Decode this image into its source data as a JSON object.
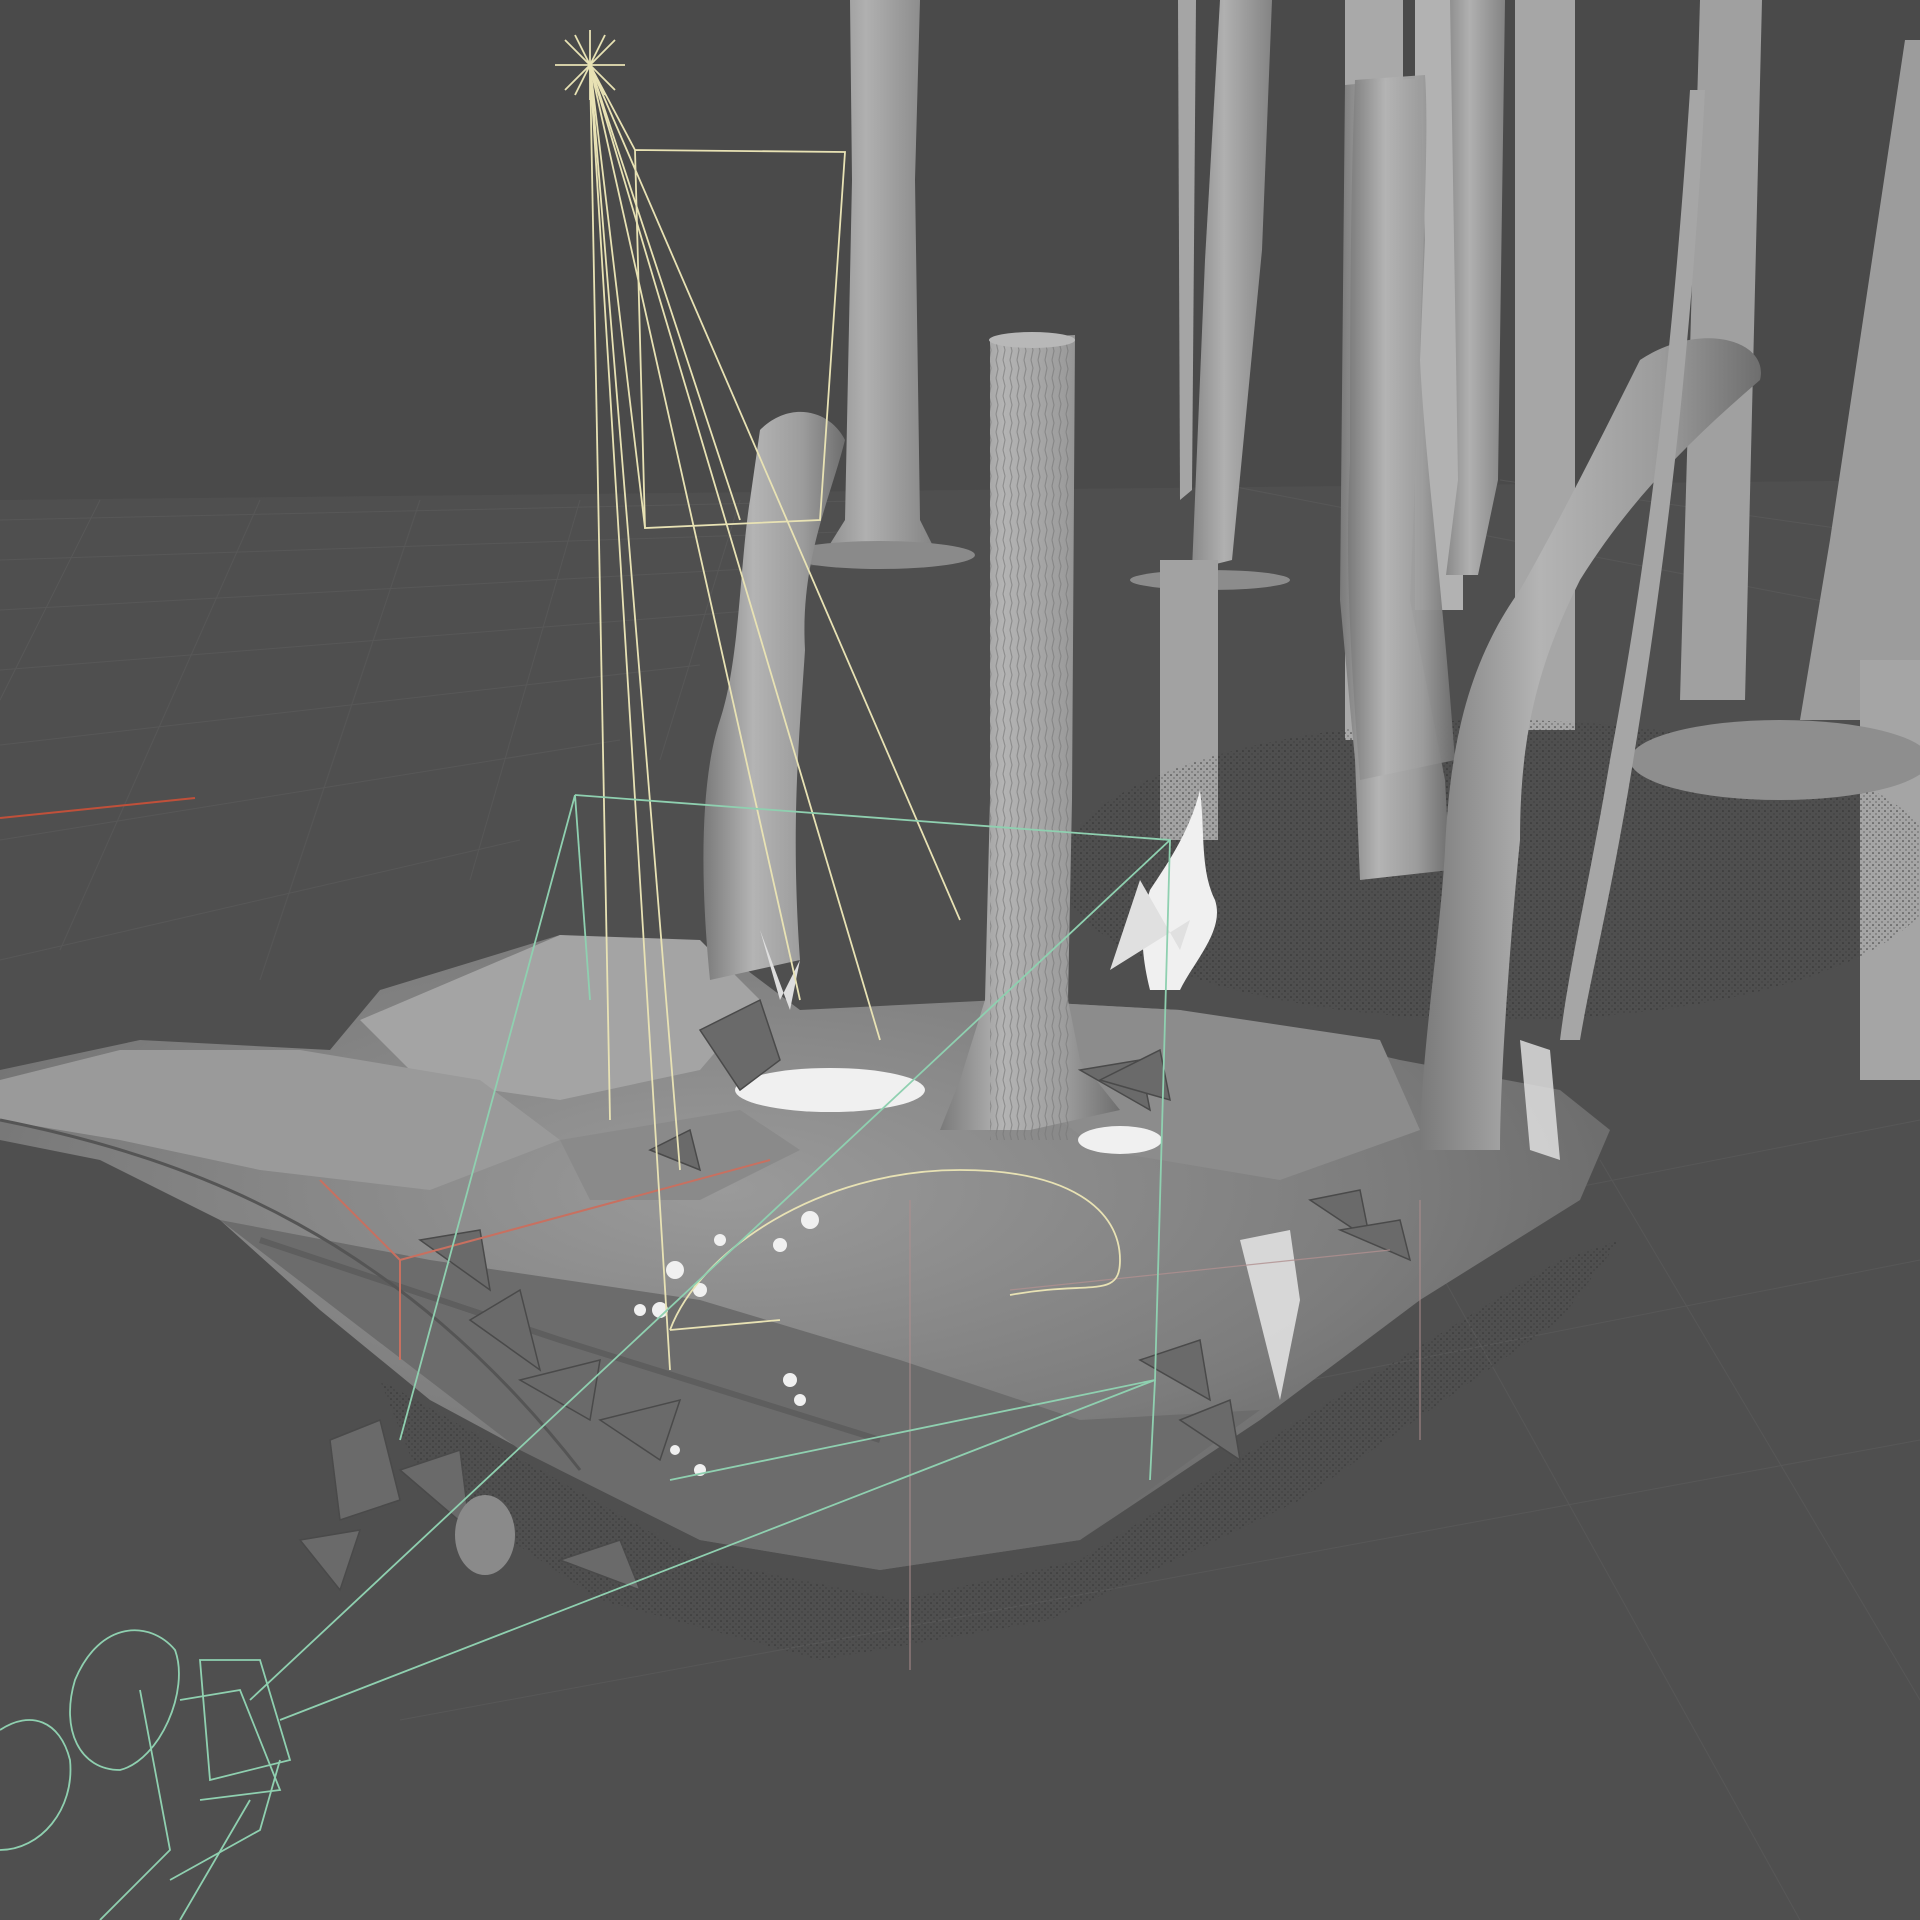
{
  "viewport": {
    "background": "#4a4a4a",
    "grid_color": "#5a5a5a",
    "ground_color": "#525252",
    "mesh_light": "#a8a8a8",
    "mesh_mid": "#8e8e8e",
    "mesh_dark": "#6a6a6a",
    "foliage_white": "#f0f0f0",
    "light_gizmo_color": "#e8e2b4",
    "camera_gizmo_color": "#8fd0b0",
    "axis_x_color": "#c0503a",
    "selection_color": "#c87060",
    "point_cloud_color": "#2e2e2e"
  },
  "objects": {
    "tree_trunks": [
      "tree-trunk",
      "tree-trunk",
      "tree-trunk",
      "tree-trunk",
      "tree-trunk",
      "tree-trunk",
      "tree-trunk",
      "tree-trunk",
      "tree-trunk",
      "tree-trunk",
      "tree-trunk"
    ],
    "terrain": "scanned-rock-terrain",
    "light": "spot-light-gizmo",
    "camera": "camera-gizmo"
  }
}
